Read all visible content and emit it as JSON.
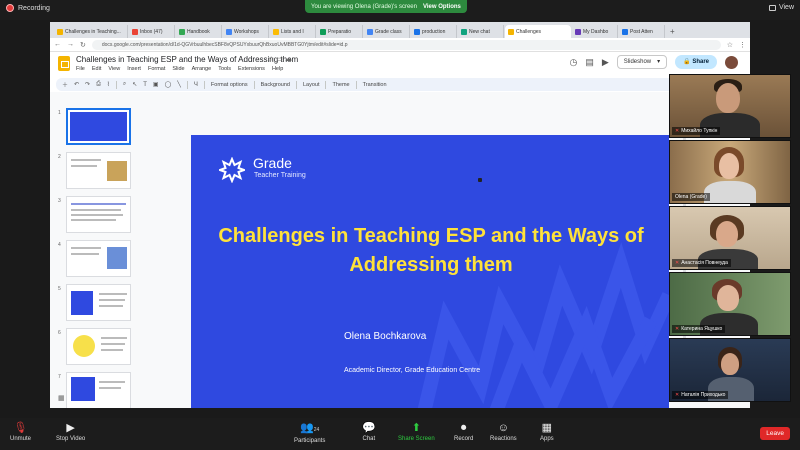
{
  "zoom": {
    "recording_label": "Recording",
    "share_banner": "You are viewing Olena (Grade)'s screen",
    "view_options": "View Options",
    "view_label": "View",
    "bottom": {
      "unmute": "Unmute",
      "stop_video": "Stop Video",
      "participants": "Participants",
      "participants_count": "24",
      "chat": "Chat",
      "share_screen": "Share Screen",
      "record": "Record",
      "reactions": "Reactions",
      "apps": "Apps",
      "leave": "Leave"
    }
  },
  "browser": {
    "tabs": [
      {
        "label": "Challenges in Teaching...",
        "color": "#f4b400"
      },
      {
        "label": "Inbox (47)",
        "color": "#ea4335"
      },
      {
        "label": "Handbook",
        "color": "#34a853"
      },
      {
        "label": "Workshops",
        "color": "#4285f4"
      },
      {
        "label": "Lists and I",
        "color": "#fbbc05"
      },
      {
        "label": "Preparatio",
        "color": "#0f9d58"
      },
      {
        "label": "Grade class",
        "color": "#4285f4"
      },
      {
        "label": "production",
        "color": "#1a73e8"
      },
      {
        "label": "New chat",
        "color": "#10a37f"
      },
      {
        "label": "Challenges",
        "color": "#f4b400"
      },
      {
        "label": "My Dashbo",
        "color": "#673ab7"
      },
      {
        "label": "Post Atten",
        "color": "#1a73e8"
      }
    ],
    "url": "docs.google.com/presentation/d/1d-QGVrbuulhbecSBF8vQPSUYxbuurQhBxuoUvMBBTG0Yjtm/edit#slide=id.p"
  },
  "slides": {
    "doc_title": "Challenges in Teaching ESP and the Ways of Addressing them",
    "menu": [
      "File",
      "Edit",
      "View",
      "Insert",
      "Format",
      "Slide",
      "Arrange",
      "Tools",
      "Extensions",
      "Help"
    ],
    "slideshow_label": "Slideshow",
    "share_label": "Share",
    "toolbar": {
      "format_options": "Format options",
      "background": "Background",
      "layout": "Layout",
      "theme": "Theme",
      "transition": "Transition"
    },
    "thumbnails": [
      "1",
      "2",
      "3",
      "4",
      "5",
      "6",
      "7"
    ],
    "current_slide": {
      "brand": "Grade",
      "brand_sub": "Teacher Training",
      "title": "Challenges in Teaching ESP and the Ways of Addressing them",
      "author": "Olena Bochkarova",
      "role": "Academic Director, Grade Education Centre"
    }
  },
  "participants": [
    {
      "name": "Михайло Тупкін"
    },
    {
      "name": "Olena (Grade)"
    },
    {
      "name": "Анастасія Повнеуда"
    },
    {
      "name": "Катерина Яцушко"
    },
    {
      "name": "Наталія Приходько"
    }
  ],
  "colors": {
    "slide_bg": "#2f49e0",
    "slide_title": "#ffe23a",
    "zoom_green": "#2d8a3e",
    "leave_red": "#e02828"
  }
}
